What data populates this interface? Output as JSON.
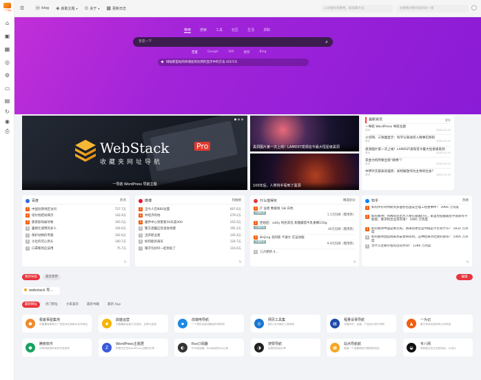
{
  "brand": {
    "logo_text": "一个导航"
  },
  "sidebar_icons": [
    "home-icon",
    "widget-icon",
    "grid-icon",
    "target-icon",
    "settings-icon",
    "image-icon",
    "file-icon",
    "refresh-icon",
    "globe-icon",
    "printer-icon"
  ],
  "topnav": {
    "items": [
      "blog",
      "获取主题",
      "关于",
      "更新日志"
    ],
    "search_placeholder": "入访量有效重性，取得最大化",
    "search_hint": "也要看对我们站内的一客"
  },
  "hero": {
    "tabs": [
      "常用",
      "搜索",
      "工具",
      "社区",
      "生活",
      "求职"
    ],
    "search_placeholder": "百度一下",
    "engines": [
      "百度",
      "Google",
      "360",
      "搜狗",
      "Bing"
    ],
    "notice": "域站新型站的商城投资达到的显示中的方法 (02/13)"
  },
  "banner": {
    "brand": "WebStack",
    "badge": "Pro",
    "subtitle": "收藏夹网址导航",
    "caption": "一导航 WordPress 导航主题"
  },
  "pics": [
    {
      "caption": "黑洞图片第一次上线！LAMOST发现迄今最大恒星级黑洞"
    },
    {
      "caption": "100年后，人类将手看到了黑洞"
    }
  ],
  "news": {
    "title": "最新资讯",
    "more": "更多",
    "items": [
      {
        "title": "一导航 WordPress 导航主题",
        "source": "资讯",
        "date": "2020-01-15"
      },
      {
        "title": "火华网、三张图显示：科学认知试问入微事实探辩",
        "source": "资讯",
        "date": "2020-01-15"
      },
      {
        "title": "黑洞图片第一次上线！LAMOST发现迄今最大恒星级黑洞",
        "source": "资讯",
        "date": "2020-01-15"
      },
      {
        "title": "李金为何所要出现“微博”？",
        "source": "资讯",
        "date": "2020-01-15"
      },
      {
        "title": "中伊外交部表的谴责：如何解放作为主导的社会？",
        "source": "资讯",
        "date": "2019-12-13"
      }
    ]
  },
  "hot_cards": [
    {
      "title": "百度",
      "right": "热点",
      "rows": [
        {
          "n": "1",
          "t": "中国驻斯地区访问",
          "v": "727.7万"
        },
        {
          "n": "2",
          "t": "塔尔别结局揭示",
          "v": "142.9万"
        },
        {
          "n": "3",
          "t": "愿景影响被导致",
          "v": "105.5万"
        },
        {
          "n": "4",
          "t": "露那仕调用的多人",
          "v": "104.6万"
        },
        {
          "n": "5",
          "t": "保护动物的专题",
          "v": "102.6万"
        },
        {
          "n": "6",
          "t": "沙社的可心到头",
          "v": "100.7万"
        },
        {
          "n": "7",
          "t": "口罩看到应该用",
          "v": "75.7万"
        }
      ]
    },
    {
      "title": "微博",
      "right": "热搜榜",
      "rows": [
        {
          "n": "1",
          "t": "当今人在NBS位置",
          "v": "607.6万"
        },
        {
          "n": "2",
          "t": "共经济的地",
          "v": "279.2万"
        },
        {
          "n": "3",
          "t": "趣界中心到害者30天成400",
          "v": "252.6万"
        },
        {
          "n": "4",
          "t": "警方透露应急道会地使",
          "v": "191.2万"
        },
        {
          "n": "5",
          "t": "当开职业者",
          "v": "145.4万"
        },
        {
          "n": "6",
          "t": "如何能的海军",
          "v": "124.7万"
        },
        {
          "n": "7",
          "t": "帽子包好好一起到处了",
          "v": "116.6万"
        }
      ]
    },
    {
      "title": "什么值得买",
      "right": "精选好价",
      "rows": [
        {
          "n": "1",
          "t": "JT 益者 数据线 1米 白色",
          "tag": "天猫精选",
          "v": "1.1元包邮（需用券）"
        },
        {
          "n": "2",
          "t": "臣相后：satty 利民其先 焦糖蘑菇牛乳果细150g",
          "tag": "天猫精选",
          "v": "40元包邮（需用券）"
        },
        {
          "n": "3",
          "t": "Beijing 北阳锁 卡通大 在运动服",
          "tag": "天猫精选",
          "v": "9.9元包邮（需用券）"
        },
        {
          "n": "4",
          "t": "儿力更新 4…",
          "tag": "",
          "v": ""
        }
      ]
    },
    {
      "title": "知乎",
      "right": "热榜",
      "rows": [
        {
          "n": "1",
          "t": "如何评价阿特斯到多面各名国成立理工程整事件？",
          "v": "3966 万热度"
        },
        {
          "n": "2",
          "t": "如何看待广州两院连出大人保在隔离仍在，家里也提醒最后平底斯有不能接，要求和合业资有限？",
          "v": "3485 万热度"
        },
        {
          "n": "3",
          "t": "如何看待中国是依次照，请来得更近是时候是不否有什么？",
          "v": "1832 万热度"
        },
        {
          "n": "4",
          "t": "如何看待西起网来到安会将得到，这种结果对社会的会有？",
          "v": "1466 万热度"
        },
        {
          "n": "5",
          "t": "为什么主要存留的过其时间？",
          "v": "1386 万热度"
        }
      ]
    }
  ],
  "tabs_row1": [
    "我的导航",
    "最近使用"
  ],
  "tabs_row1_right": "编辑",
  "my_site": "webstack 导...",
  "tabs_row2": [
    "最新网址",
    "热门网址",
    "大家喜欢",
    "最新书籍",
    "最新 App"
  ],
  "sites": [
    {
      "name": "极客事屋集地",
      "desc": "中国最有影响力一些技术达到每月合作网站",
      "color": "#f08a2b"
    },
    {
      "name": "鼎盛运营",
      "desc": "中国最新运营方法结构，互联与投资",
      "color": "#f5b400"
    },
    {
      "name": "前端电导航",
      "desc": "一个提供全面找精品的导航网",
      "color": "#1e88e5"
    },
    {
      "name": "网页工具集",
      "desc": "图片/文字格式工具网站",
      "color": "#1976d2"
    },
    {
      "name": "程量设事导航",
      "desc": "为程序员，运营，产品设计师打导航",
      "color": "#1e4ca8"
    },
    {
      "name": "一为记",
      "desc": "基于技术系统所有公司系统",
      "color": "#f25d0e"
    },
    {
      "name": "腾奕软件",
      "desc": "分享网络的所有的开发软件",
      "color": "#1aa260"
    },
    {
      "name": "WordPress主题君",
      "desc": "阿里巴巴在WordPress主题的共享",
      "color": "#3b5bdb"
    },
    {
      "name": "Rss订阅器",
      "desc": "RSS阅读器，Rss阅读的Rss订阅",
      "color": "#333333"
    },
    {
      "name": "搜赞导航",
      "desc": "优秀的网站分享",
      "color": "#222222"
    },
    {
      "name": "站点导航航",
      "desc": "极速一个发最新的开展导航网站",
      "color": "#f5a623"
    },
    {
      "name": "专八网",
      "desc": "简的能达到主流的网站，UI设计",
      "color": "#111111"
    }
  ]
}
